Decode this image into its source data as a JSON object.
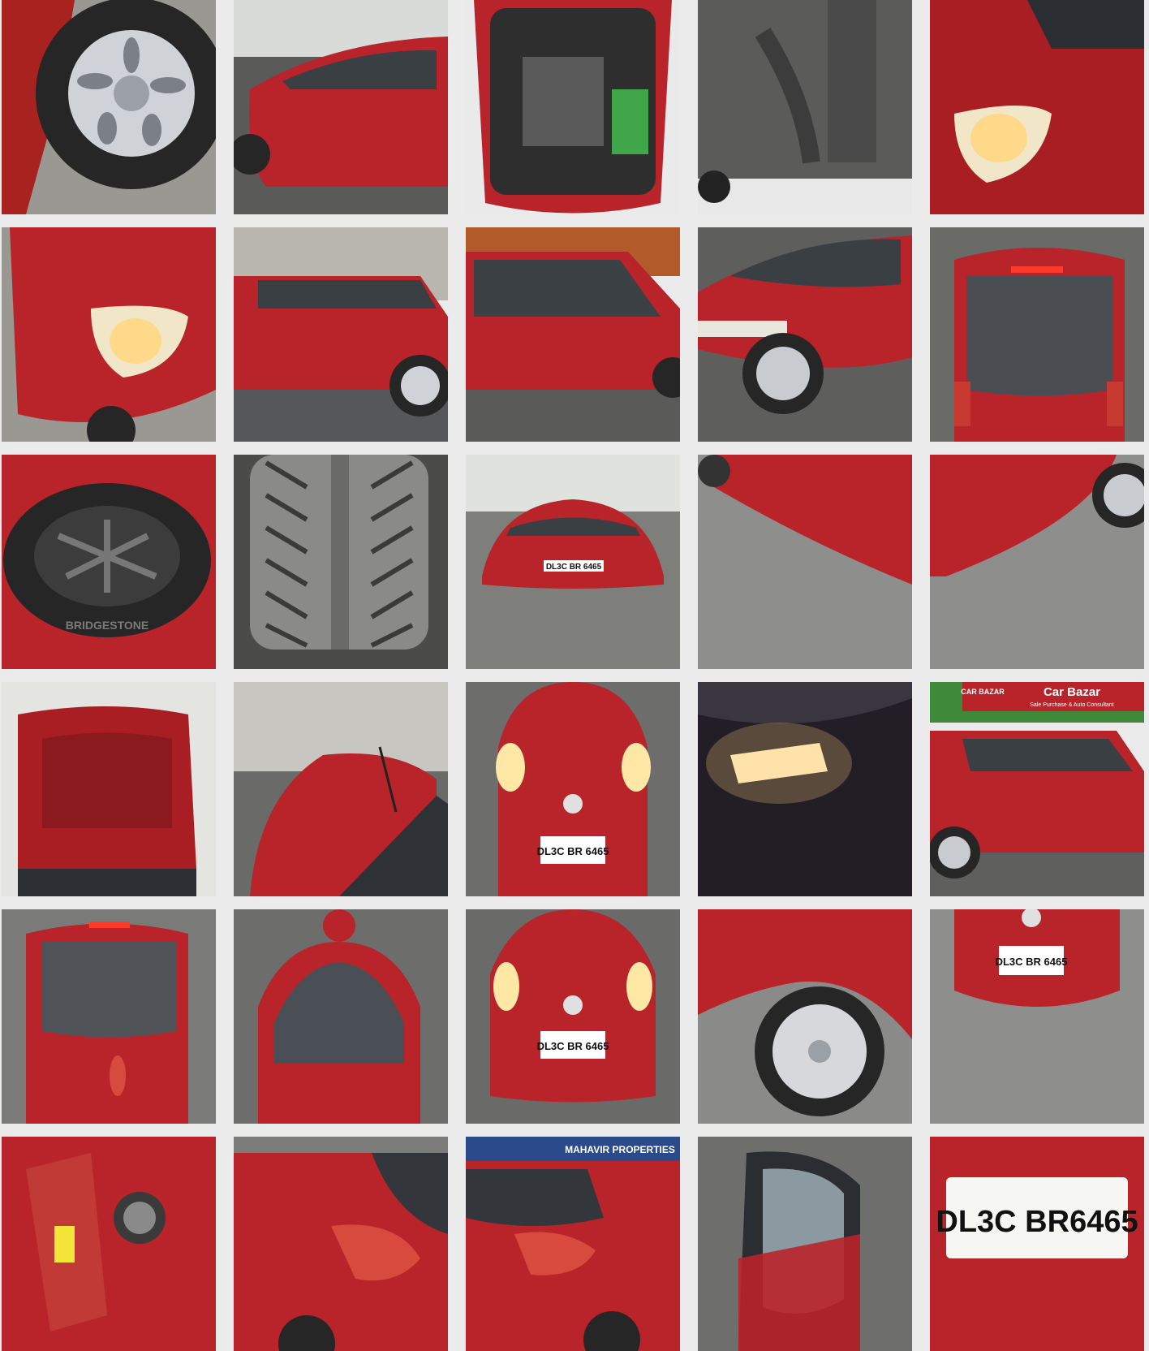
{
  "gallery": {
    "columns": 5,
    "photos": [
      {
        "subject": "front-wheel"
      },
      {
        "subject": "car-side-driver"
      },
      {
        "subject": "engine-bay"
      },
      {
        "subject": "underbody"
      },
      {
        "subject": "headlight-right"
      },
      {
        "subject": "headlight-left"
      },
      {
        "subject": "car-side-view"
      },
      {
        "subject": "car-side-doors"
      },
      {
        "subject": "front-quarter"
      },
      {
        "subject": "rear-view"
      },
      {
        "subject": "spare-wheel",
        "text": "BRIDGESTONE"
      },
      {
        "subject": "tyre-tread"
      },
      {
        "subject": "car-front-full",
        "plate": "DL3C BR 6465"
      },
      {
        "subject": "rocker-panel-left"
      },
      {
        "subject": "rocker-panel-right"
      },
      {
        "subject": "hood-open"
      },
      {
        "subject": "roof-view"
      },
      {
        "subject": "front-grille",
        "plate": "DL3C BR 6465"
      },
      {
        "subject": "interior-light"
      },
      {
        "subject": "car-side-dealer",
        "sign_left": "CAR BAZAR",
        "sign_right": "Car Bazar",
        "sign_tagline": "Sale Purchase & Auto Consultant"
      },
      {
        "subject": "rear-view-street"
      },
      {
        "subject": "windshield-view"
      },
      {
        "subject": "front-grille-2",
        "plate": "DL3C BR 6465"
      },
      {
        "subject": "rear-wheel"
      },
      {
        "subject": "front-bumper",
        "plate": "DL3C BR 6465"
      },
      {
        "subject": "fuel-cap"
      },
      {
        "subject": "rear-quarter-left"
      },
      {
        "subject": "rear-quarter-right",
        "sign": "MAHAVIR PROPERTIES"
      },
      {
        "subject": "side-mirror"
      },
      {
        "subject": "plate-closeup",
        "plate": "DL3C BR6465"
      }
    ]
  },
  "colors": {
    "car_red": "#b8242a",
    "tyre": "#2a2a2a",
    "road": "#8a8a86"
  }
}
